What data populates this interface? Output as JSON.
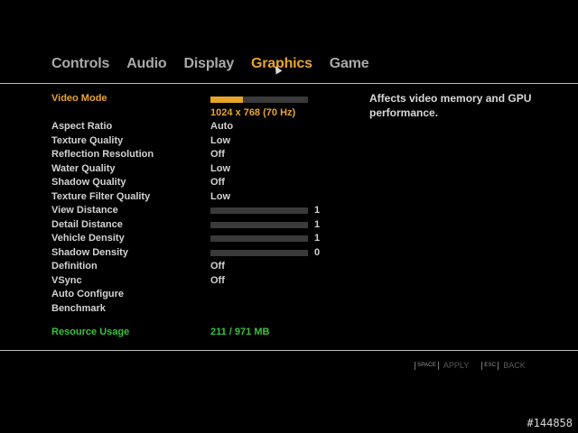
{
  "tabs": [
    {
      "label": "Controls",
      "active": false
    },
    {
      "label": "Audio",
      "active": false
    },
    {
      "label": "Display",
      "active": false
    },
    {
      "label": "Graphics",
      "active": true
    },
    {
      "label": "Game",
      "active": false
    }
  ],
  "video_mode": {
    "label": "Video Mode",
    "value": "1024 x 768 (70 Hz)",
    "level": 0.33
  },
  "settings": {
    "aspect_ratio": {
      "label": "Aspect Ratio",
      "value": "Auto"
    },
    "texture_quality": {
      "label": "Texture Quality",
      "value": "Low"
    },
    "reflection_resolution": {
      "label": "Reflection Resolution",
      "value": "Off"
    },
    "water_quality": {
      "label": "Water Quality",
      "value": "Low"
    },
    "shadow_quality": {
      "label": "Shadow Quality",
      "value": "Off"
    },
    "texture_filter_quality": {
      "label": "Texture Filter Quality",
      "value": "Low"
    },
    "view_distance": {
      "label": "View Distance",
      "value": "1",
      "level": 0
    },
    "detail_distance": {
      "label": "Detail Distance",
      "value": "1",
      "level": 0
    },
    "vehicle_density": {
      "label": "Vehicle Density",
      "value": "1",
      "level": 0
    },
    "shadow_density": {
      "label": "Shadow Density",
      "value": "0",
      "level": 0
    },
    "definition": {
      "label": "Definition",
      "value": "Off"
    },
    "vsync": {
      "label": "VSync",
      "value": "Off"
    },
    "auto_configure": {
      "label": "Auto Configure"
    },
    "benchmark": {
      "label": "Benchmark"
    }
  },
  "resource_usage": {
    "label": "Resource Usage",
    "value": "211 / 971 MB"
  },
  "description": "Affects video memory and GPU performance.",
  "hints": {
    "apply_key": "SPACE",
    "apply_label": "APPLY",
    "back_key": "ESC",
    "back_label": "BACK"
  },
  "watermark": "#144858",
  "colors": {
    "accent": "#e8a52a",
    "resource": "#39c43c",
    "text": "#d2d2d2",
    "inactive_tab": "#a9a9a9"
  }
}
